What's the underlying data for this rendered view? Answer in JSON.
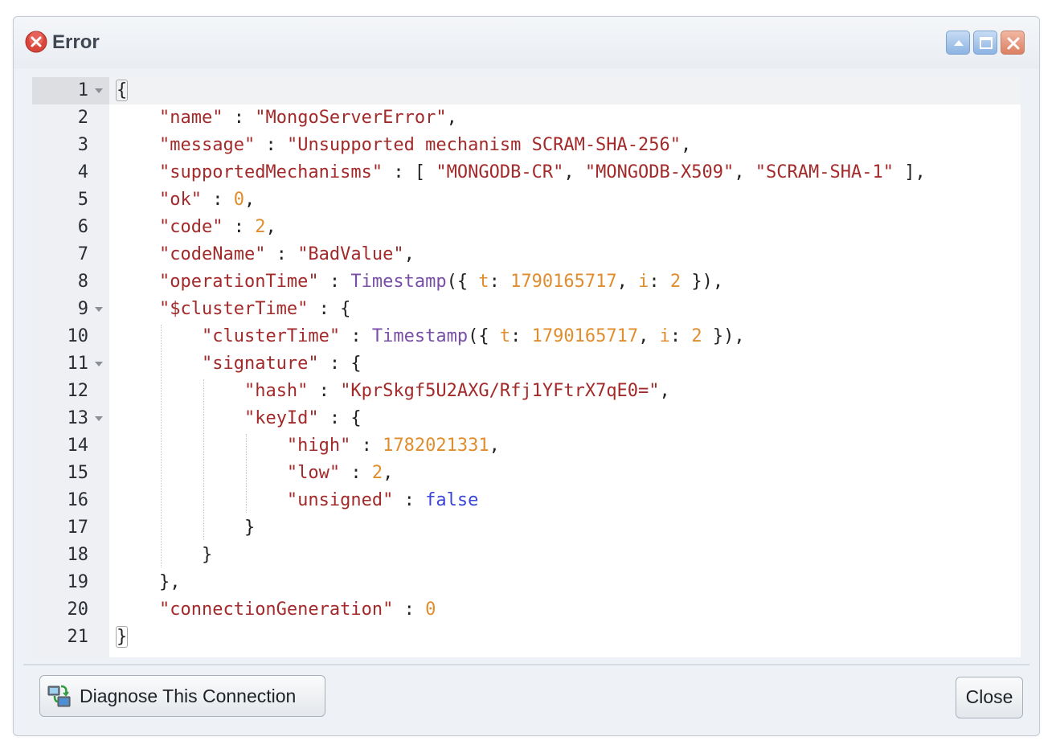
{
  "window": {
    "title": "Error",
    "icon": "error-icon",
    "controls": [
      "collapse-icon",
      "maximize-icon",
      "close-icon"
    ]
  },
  "editor": {
    "line_numbers": [
      "1",
      "2",
      "3",
      "4",
      "5",
      "6",
      "7",
      "8",
      "9",
      "10",
      "11",
      "12",
      "13",
      "14",
      "15",
      "16",
      "17",
      "18",
      "19",
      "20",
      "21"
    ],
    "foldable_lines": [
      1,
      9,
      11,
      13
    ],
    "lines": [
      [
        {
          "t": "{",
          "c": "p",
          "m": true
        }
      ],
      [
        {
          "t": "    "
        },
        {
          "t": "\"name\"",
          "c": "k"
        },
        {
          "t": " : "
        },
        {
          "t": "\"MongoServerError\"",
          "c": "s"
        },
        {
          "t": ","
        }
      ],
      [
        {
          "t": "    "
        },
        {
          "t": "\"message\"",
          "c": "k"
        },
        {
          "t": " : "
        },
        {
          "t": "\"Unsupported mechanism SCRAM-SHA-256\"",
          "c": "s"
        },
        {
          "t": ","
        }
      ],
      [
        {
          "t": "    "
        },
        {
          "t": "\"supportedMechanisms\"",
          "c": "k"
        },
        {
          "t": " : [ "
        },
        {
          "t": "\"MONGODB-CR\"",
          "c": "s"
        },
        {
          "t": ", "
        },
        {
          "t": "\"MONGODB-X509\"",
          "c": "s"
        },
        {
          "t": ", "
        },
        {
          "t": "\"SCRAM-SHA-1\"",
          "c": "s"
        },
        {
          "t": " ],"
        }
      ],
      [
        {
          "t": "    "
        },
        {
          "t": "\"ok\"",
          "c": "k"
        },
        {
          "t": " : "
        },
        {
          "t": "0",
          "c": "n"
        },
        {
          "t": ","
        }
      ],
      [
        {
          "t": "    "
        },
        {
          "t": "\"code\"",
          "c": "k"
        },
        {
          "t": " : "
        },
        {
          "t": "2",
          "c": "n"
        },
        {
          "t": ","
        }
      ],
      [
        {
          "t": "    "
        },
        {
          "t": "\"codeName\"",
          "c": "k"
        },
        {
          "t": " : "
        },
        {
          "t": "\"BadValue\"",
          "c": "s"
        },
        {
          "t": ","
        }
      ],
      [
        {
          "t": "    "
        },
        {
          "t": "\"operationTime\"",
          "c": "k"
        },
        {
          "t": " : "
        },
        {
          "t": "Timestamp",
          "c": "f"
        },
        {
          "t": "({ "
        },
        {
          "t": "t",
          "c": "n"
        },
        {
          "t": ": "
        },
        {
          "t": "1790165717",
          "c": "n"
        },
        {
          "t": ", "
        },
        {
          "t": "i",
          "c": "n"
        },
        {
          "t": ": "
        },
        {
          "t": "2",
          "c": "n"
        },
        {
          "t": " }),"
        }
      ],
      [
        {
          "t": "    "
        },
        {
          "t": "\"$clusterTime\"",
          "c": "k"
        },
        {
          "t": " : {"
        }
      ],
      [
        {
          "t": "        "
        },
        {
          "t": "\"clusterTime\"",
          "c": "k"
        },
        {
          "t": " : "
        },
        {
          "t": "Timestamp",
          "c": "f"
        },
        {
          "t": "({ "
        },
        {
          "t": "t",
          "c": "n"
        },
        {
          "t": ": "
        },
        {
          "t": "1790165717",
          "c": "n"
        },
        {
          "t": ", "
        },
        {
          "t": "i",
          "c": "n"
        },
        {
          "t": ": "
        },
        {
          "t": "2",
          "c": "n"
        },
        {
          "t": " }),"
        }
      ],
      [
        {
          "t": "        "
        },
        {
          "t": "\"signature\"",
          "c": "k"
        },
        {
          "t": " : {"
        }
      ],
      [
        {
          "t": "            "
        },
        {
          "t": "\"hash\"",
          "c": "k"
        },
        {
          "t": " : "
        },
        {
          "t": "\"KprSkgf5U2AXG/Rfj1YFtrX7qE0=\"",
          "c": "s"
        },
        {
          "t": ","
        }
      ],
      [
        {
          "t": "            "
        },
        {
          "t": "\"keyId\"",
          "c": "k"
        },
        {
          "t": " : {"
        }
      ],
      [
        {
          "t": "                "
        },
        {
          "t": "\"high\"",
          "c": "k"
        },
        {
          "t": " : "
        },
        {
          "t": "1782021331",
          "c": "n"
        },
        {
          "t": ","
        }
      ],
      [
        {
          "t": "                "
        },
        {
          "t": "\"low\"",
          "c": "k"
        },
        {
          "t": " : "
        },
        {
          "t": "2",
          "c": "n"
        },
        {
          "t": ","
        }
      ],
      [
        {
          "t": "                "
        },
        {
          "t": "\"unsigned\"",
          "c": "k"
        },
        {
          "t": " : "
        },
        {
          "t": "false",
          "c": "b"
        }
      ],
      [
        {
          "t": "            }"
        }
      ],
      [
        {
          "t": "        }"
        }
      ],
      [
        {
          "t": "    },"
        }
      ],
      [
        {
          "t": "    "
        },
        {
          "t": "\"connectionGeneration\"",
          "c": "k"
        },
        {
          "t": " : "
        },
        {
          "t": "0",
          "c": "n"
        }
      ],
      [
        {
          "t": "}",
          "c": "p",
          "m": true
        }
      ]
    ]
  },
  "footer": {
    "diagnose_label": "Diagnose This Connection",
    "diagnose_icon": "network-diagnose-icon",
    "close_label": "Close"
  }
}
